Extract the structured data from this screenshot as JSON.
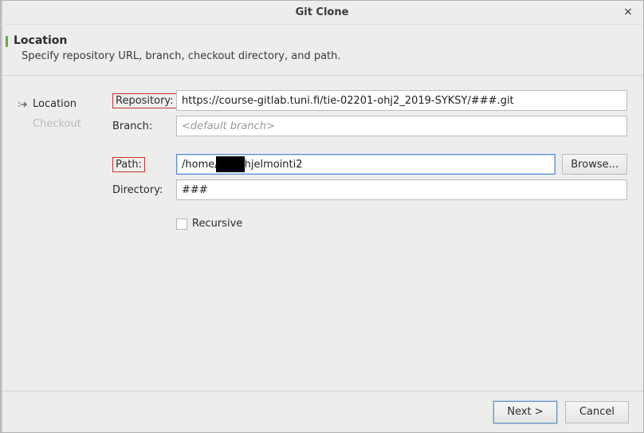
{
  "window": {
    "title": "Git Clone",
    "close_label": "×"
  },
  "header": {
    "title": "Location",
    "subtitle": "Specify repository URL, branch, checkout directory, and path."
  },
  "sidebar": {
    "items": [
      {
        "label": "Location",
        "enabled": true
      },
      {
        "label": "Checkout",
        "enabled": false
      }
    ]
  },
  "form": {
    "repository": {
      "label": "Repository:",
      "value": "https://course-gitlab.tuni.fi/tie-02201-ohj2_2019-SYKSY/###.git"
    },
    "branch": {
      "label": "Branch:",
      "value": "",
      "placeholder": "<default branch>"
    },
    "path": {
      "label": "Path:",
      "value_prefix": "/home/",
      "value_suffix": "/ohjelmointi2",
      "browse_label": "Browse..."
    },
    "directory": {
      "label": "Directory:",
      "value": "###"
    },
    "recursive": {
      "label": "Recursive",
      "checked": false
    }
  },
  "footer": {
    "next_label": "Next >",
    "cancel_label": "Cancel"
  }
}
